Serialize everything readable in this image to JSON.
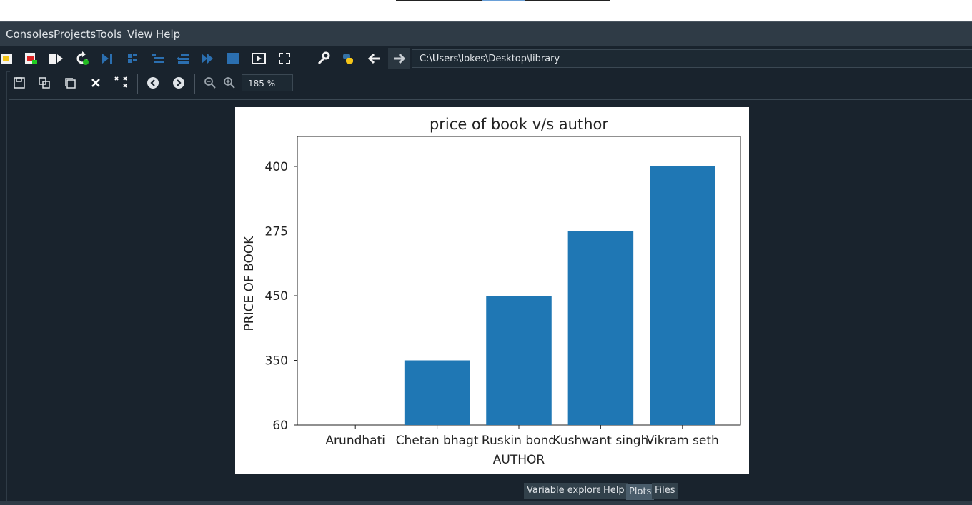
{
  "menu": {
    "items": [
      "Consoles",
      "Projects",
      "Tools",
      "View",
      "Help"
    ]
  },
  "toolbar": {
    "path": "C:\\Users\\lokes\\Desktop\\library"
  },
  "plots_toolbar": {
    "zoom": "185 %"
  },
  "tabs": [
    {
      "label": "Variable explorer",
      "active": false
    },
    {
      "label": "Help",
      "active": false
    },
    {
      "label": "Plots",
      "active": true
    },
    {
      "label": "Files",
      "active": false
    }
  ],
  "chart_data": {
    "type": "bar",
    "title": "price of book v/s author",
    "xlabel": "AUTHOR",
    "ylabel": "PRICE OF BOOK",
    "categories": [
      "Arundhati",
      "Chetan bhagt",
      "Ruskin bond",
      "Kushwant singh",
      "Vikram seth"
    ],
    "values": [
      "60",
      "350",
      "450",
      "275",
      "400"
    ],
    "y_tick_labels": [
      "60",
      "350",
      "450",
      "275",
      "400"
    ],
    "y_is_categorical": true,
    "bar_color": "#1f77b4",
    "grid": false
  }
}
